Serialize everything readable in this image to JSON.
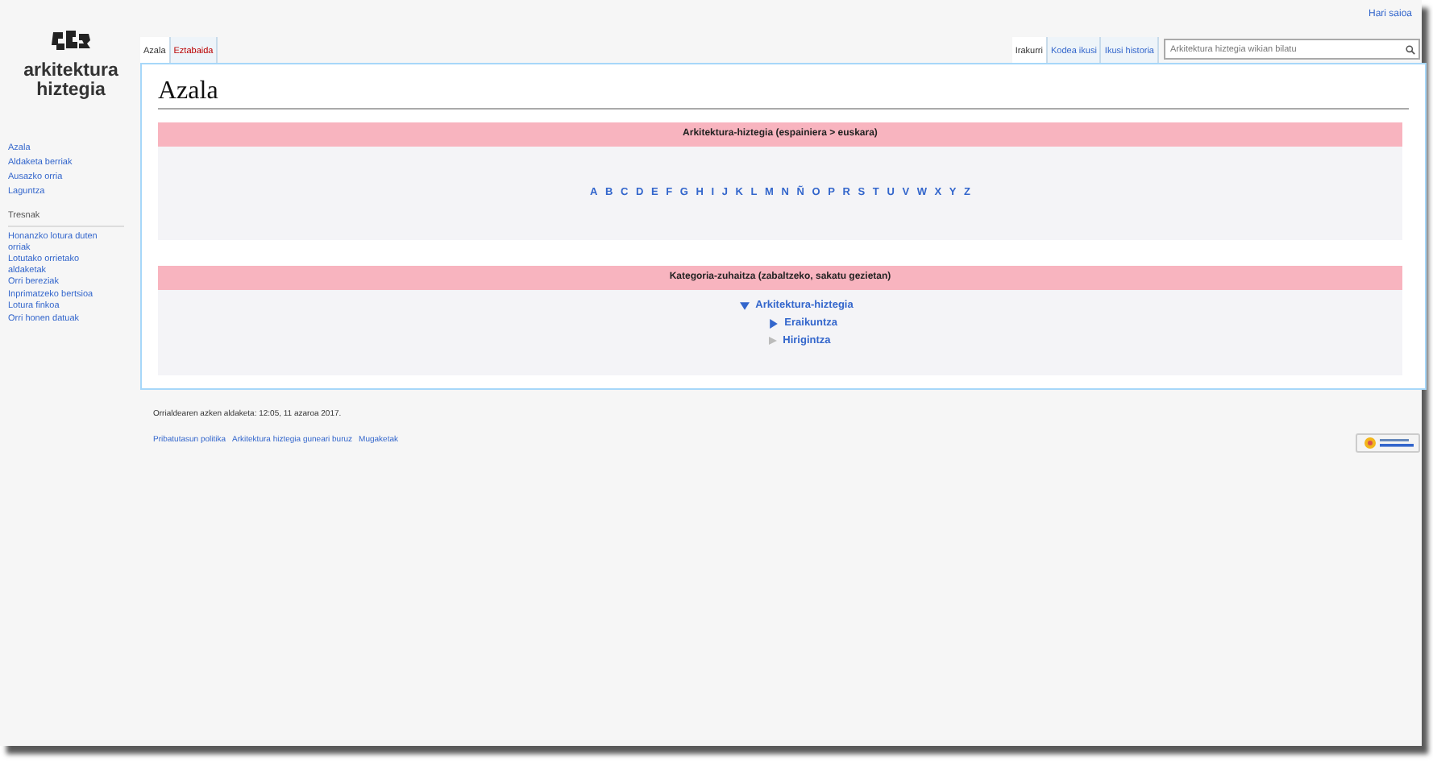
{
  "personal_link": "Hari saioa",
  "logo": {
    "line_1": "arkitektura",
    "line_2": "hiztegia"
  },
  "sidebar": {
    "navigation": [
      "Azala",
      "Aldaketa berriak",
      "Ausazko orria",
      "Laguntza"
    ],
    "tools_heading": "Tresnak",
    "tools": [
      "Honanzko lotura duten orriak",
      "Lotutako orrietako aldaketak",
      "Orri bereziak",
      "Inprimatzeko bertsioa",
      "Lotura finkoa",
      "Orri honen datuak"
    ]
  },
  "left_tabs": [
    {
      "label": "Azala",
      "selected": true,
      "missing": false
    },
    {
      "label": "Eztabaida",
      "selected": false,
      "missing": true
    }
  ],
  "right_tabs": [
    {
      "label": "Irakurri",
      "selected": true
    },
    {
      "label": "Kodea ikusi",
      "selected": false
    },
    {
      "label": "Ikusi historia",
      "selected": false
    }
  ],
  "search": {
    "placeholder": "Arkitektura hiztegia wikian bilatu"
  },
  "page_title": "Azala",
  "dictionary_box": {
    "title": "Arkitektura-hiztegia (espainiera > euskara)",
    "letters": [
      "A",
      "B",
      "C",
      "D",
      "E",
      "F",
      "G",
      "H",
      "I",
      "J",
      "K",
      "L",
      "M",
      "N",
      "Ñ",
      "O",
      "P",
      "R",
      "S",
      "T",
      "U",
      "V",
      "W",
      "X",
      "Y",
      "Z"
    ]
  },
  "category_box": {
    "title": "Kategoria-zuhaitza (zabaltzeko, sakatu gezietan)",
    "tree": [
      {
        "label": "Arkitektura-hiztegia",
        "kind": "branch",
        "expanded": true,
        "children": [
          {
            "label": "Eraikuntza",
            "kind": "branch",
            "expanded": false
          },
          {
            "label": "Hirigintza",
            "kind": "leaf"
          }
        ]
      }
    ]
  },
  "footer": {
    "last_modified": "Orrialdearen azken aldaketa: 12:05, 11 azaroa 2017.",
    "links": [
      "Pribatutasun politika",
      "Arkitektura hiztegia guneari buruz",
      "Mugaketak"
    ]
  }
}
